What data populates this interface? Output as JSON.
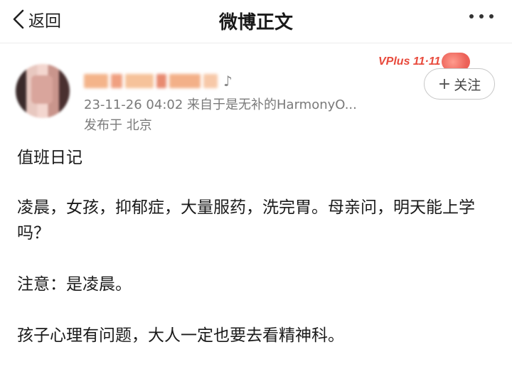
{
  "nav": {
    "back_label": "返回",
    "title": "微博正文"
  },
  "post": {
    "time_source": "23-11-26 04:02  来自于是无补的HarmonyO...",
    "location": "发布于 北京",
    "vplus_label": "VPlus 11·11",
    "follow_label": "关注",
    "follow_icon": "plus-icon",
    "paragraphs": [
      "值班日记",
      "凌晨，女孩，抑郁症，大量服药，洗完胃。母亲问，明天能上学吗？",
      "注意：是凌晨。",
      "孩子心理有问题，大人一定也要去看精神科。"
    ]
  },
  "colors": {
    "accent": "#e84a3c",
    "meta_text": "#7a7a7a"
  }
}
